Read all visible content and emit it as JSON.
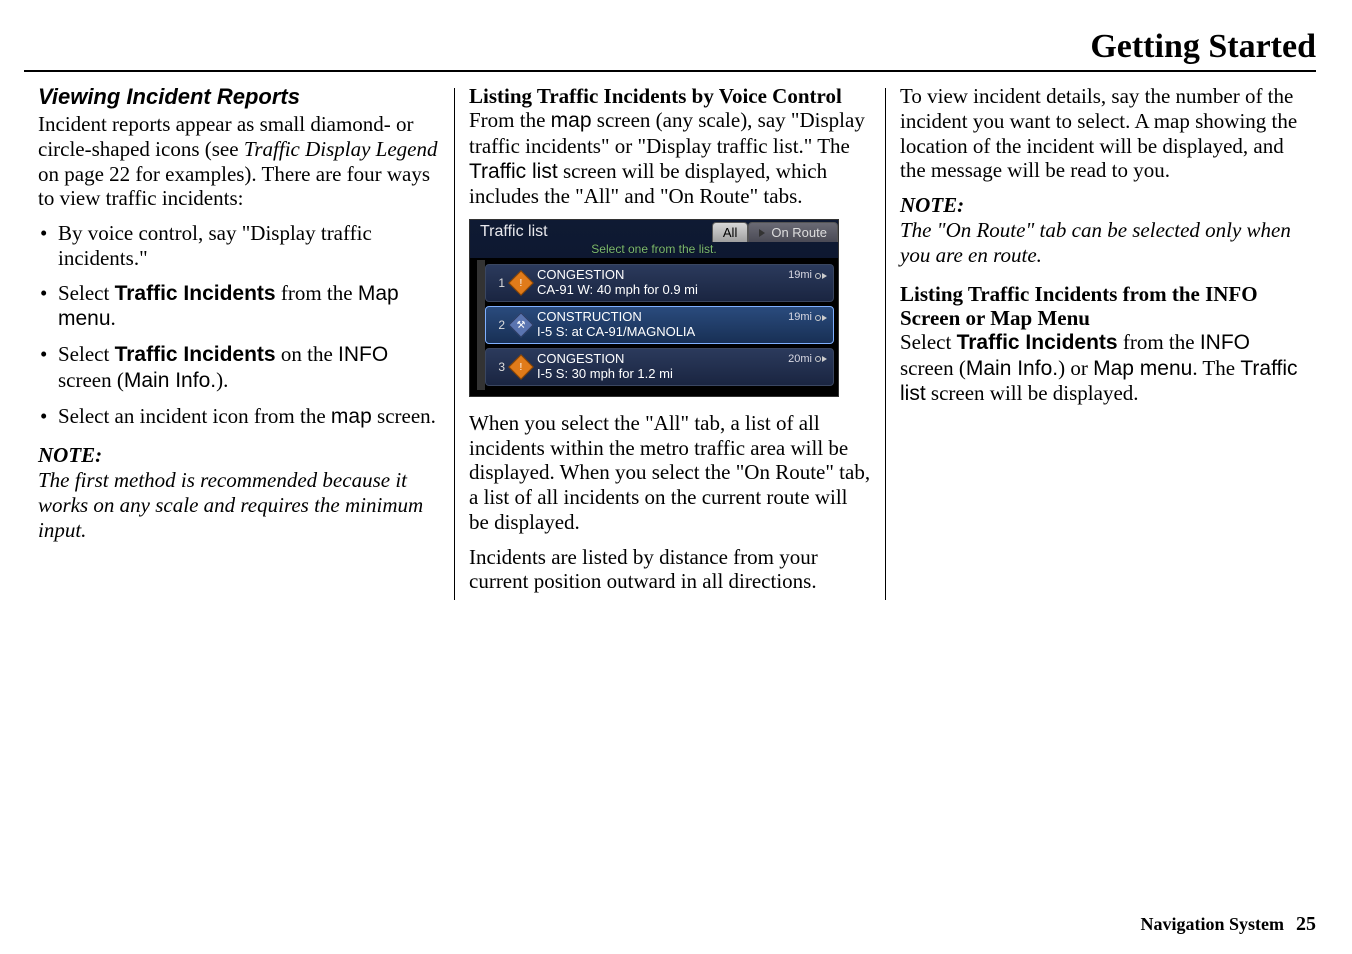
{
  "header": {
    "title": "Getting Started"
  },
  "col1": {
    "heading": "Viewing Incident Reports",
    "intro_pre": "Incident reports appear as small diamond- or circle-shaped icons (see ",
    "intro_ref": "Traffic Display Legend",
    "intro_post": " on page 22 for examples). There are four ways to view traffic incidents:",
    "bullets": [
      {
        "text": "By voice control, say \"Display traffic incidents.\""
      },
      {
        "pre": "Select ",
        "strong": "Traffic Incidents",
        "mid": " from the ",
        "sans": "Map menu",
        "post": "."
      },
      {
        "pre": "Select ",
        "strong": "Traffic Incidents",
        "mid": " on the ",
        "sans1": "INFO",
        "mid2": " screen (",
        "sans2": "Main Info.",
        "post": ")."
      },
      {
        "pre": "Select an incident icon from the ",
        "sans": "map",
        "post": " screen."
      }
    ],
    "note_label": "NOTE:",
    "note_body": "The first method is recommended because it works on any scale and requires the minimum input."
  },
  "col2": {
    "heading": "Listing Traffic Incidents by Voice Control",
    "p1_pre": "From the ",
    "p1_sans1": "map",
    "p1_mid": " screen (any scale), say \"Display traffic incidents\" or \"Display traffic list.\" The ",
    "p1_sans2": "Traffic list",
    "p1_post": " screen will be displayed, which includes the \"All\" and \"On Route\" tabs.",
    "screenshot": {
      "title": "Traffic list",
      "tab_all": "All",
      "tab_onroute": "On Route",
      "subtitle": "Select one from the list.",
      "rows": [
        {
          "n": "1",
          "icon": "orange",
          "t1": "CONGESTION",
          "dist": "19mi",
          "t2": "CA-91 W: 40 mph for 0.9 mi"
        },
        {
          "n": "2",
          "icon": "blue",
          "t1": "CONSTRUCTION",
          "dist": "19mi",
          "t2": "I-5 S: at CA-91/MAGNOLIA",
          "sel": true
        },
        {
          "n": "3",
          "icon": "orange",
          "t1": "CONGESTION",
          "dist": "20mi",
          "t2": "I-5 S: 30 mph for 1.2 mi"
        }
      ]
    },
    "p2": "When you select the \"All\" tab, a list of all incidents within the metro traffic area will be displayed. When you select the \"On Route\" tab, a list of all incidents on the current route will be displayed.",
    "p3": "Incidents are listed by distance from your current position outward in all directions."
  },
  "col3": {
    "p1": "To view incident details, say the number of the incident you want to select. A map showing the location of the incident will be displayed, and the message will be read to you.",
    "note_label": "NOTE:",
    "note_body": "The \"On Route\" tab can be selected only when you are en route.",
    "heading": "Listing Traffic Incidents from the INFO Screen or Map Menu",
    "p2_pre": "Select ",
    "p2_strong": "Traffic Incidents",
    "p2_mid1": " from the ",
    "p2_sans1": "INFO",
    "p2_mid2": " screen (",
    "p2_sans2": "Main Info.",
    "p2_mid3": ") or ",
    "p2_sans3": "Map menu",
    "p2_mid4": ". The ",
    "p2_sans4": "Traffic list",
    "p2_post": " screen will be displayed."
  },
  "footer": {
    "label": "Navigation System",
    "page": "25"
  }
}
